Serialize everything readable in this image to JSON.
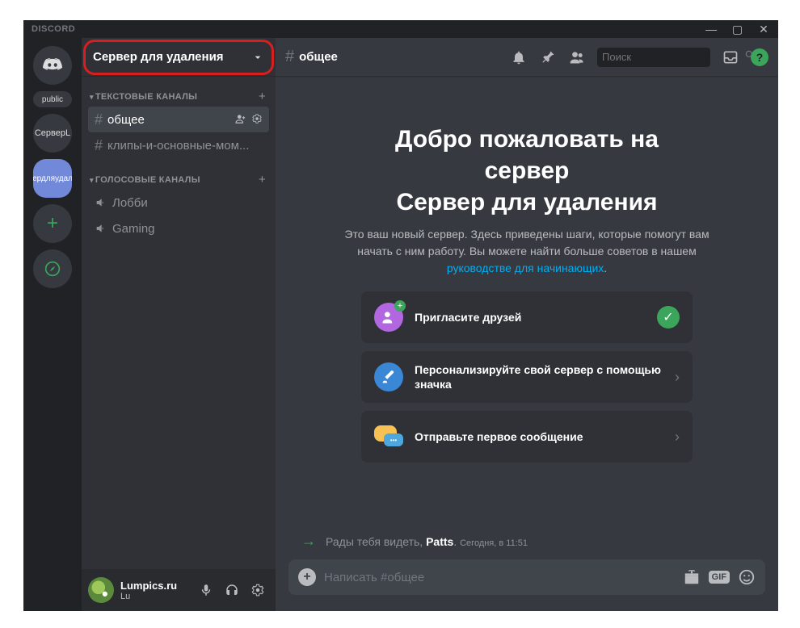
{
  "titlebar": {
    "app": "DISCORD"
  },
  "servers": {
    "public_label": "public",
    "s1": "СерверL",
    "s2": "ердляудал"
  },
  "channels": {
    "server_name": "Сервер для удаления",
    "cat_text": "ТЕКСТОВЫЕ КАНАЛЫ",
    "cat_voice": "ГОЛОСОВЫЕ КАНАЛЫ",
    "text": {
      "0": {
        "name": "общее"
      },
      "1": {
        "name": "клипы-и-основные-мом..."
      }
    },
    "voice": {
      "0": {
        "name": "Лобби"
      },
      "1": {
        "name": "Gaming"
      }
    }
  },
  "user": {
    "name": "Lumpics.ru",
    "sub": "Lu"
  },
  "header": {
    "channel": "общее",
    "search_placeholder": "Поиск"
  },
  "welcome": {
    "line1": "Добро пожаловать на",
    "line2": "сервер",
    "line3": "Сервер для удаления",
    "desc1": "Это ваш новый сервер. Здесь приведены шаги, которые помогут вам начать с ним работу. Вы можете найти больше советов в нашем ",
    "desc_link": "руководстве для начинающих",
    "desc2": "."
  },
  "cards": {
    "0": {
      "label": "Пригласите друзей"
    },
    "1": {
      "label": "Персонализируйте свой сервер с помощью значка"
    },
    "2": {
      "label": "Отправьте первое сообщение"
    }
  },
  "join": {
    "prefix": "Рады тебя видеть, ",
    "user": "Patts",
    "suffix": ".",
    "time": "Сегодня, в 11:51"
  },
  "input": {
    "placeholder": "Написать #общее",
    "gif": "GIF"
  }
}
